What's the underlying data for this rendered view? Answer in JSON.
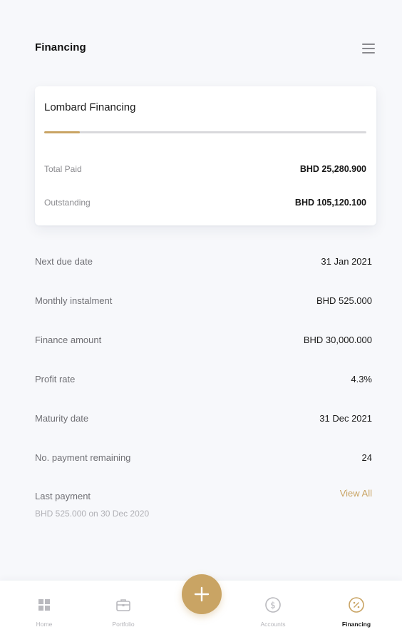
{
  "header": {
    "title": "Financing",
    "menu_icon": "hamburger-menu-icon"
  },
  "card": {
    "title": "Lombard Financing",
    "progress_paid_fraction": 0.11,
    "total_paid_label": "Total Paid",
    "total_paid_value": "BHD 25,280.900",
    "outstanding_label": "Outstanding",
    "outstanding_value": "BHD 105,120.100"
  },
  "details": [
    {
      "label": "Next due date",
      "value": "31 Jan 2021"
    },
    {
      "label": "Monthly instalment",
      "value": "BHD 525.000"
    },
    {
      "label": "Finance amount",
      "value": "BHD 30,000.000"
    },
    {
      "label": "Profit rate",
      "value": "4.3%"
    },
    {
      "label": "Maturity date",
      "value": "31 Dec 2021"
    },
    {
      "label": "No. payment remaining",
      "value": "24"
    }
  ],
  "last_payment": {
    "label": "Last payment",
    "detail": "BHD 525.000 on 30 Dec 2020",
    "view_all": "View All"
  },
  "bottom_nav": {
    "items": [
      {
        "label": "Home",
        "icon": "grid-icon"
      },
      {
        "label": "Portfolio",
        "icon": "briefcase-icon"
      },
      {
        "label": "Accounts",
        "icon": "dollar-circle-icon"
      },
      {
        "label": "Financing",
        "icon": "percent-circle-icon"
      }
    ],
    "active": "Financing",
    "fab_icon": "plus-icon"
  },
  "colors": {
    "accent": "#c9a464",
    "background": "#f7f8fb",
    "card": "#ffffff",
    "muted_text": "#8c8c90"
  }
}
